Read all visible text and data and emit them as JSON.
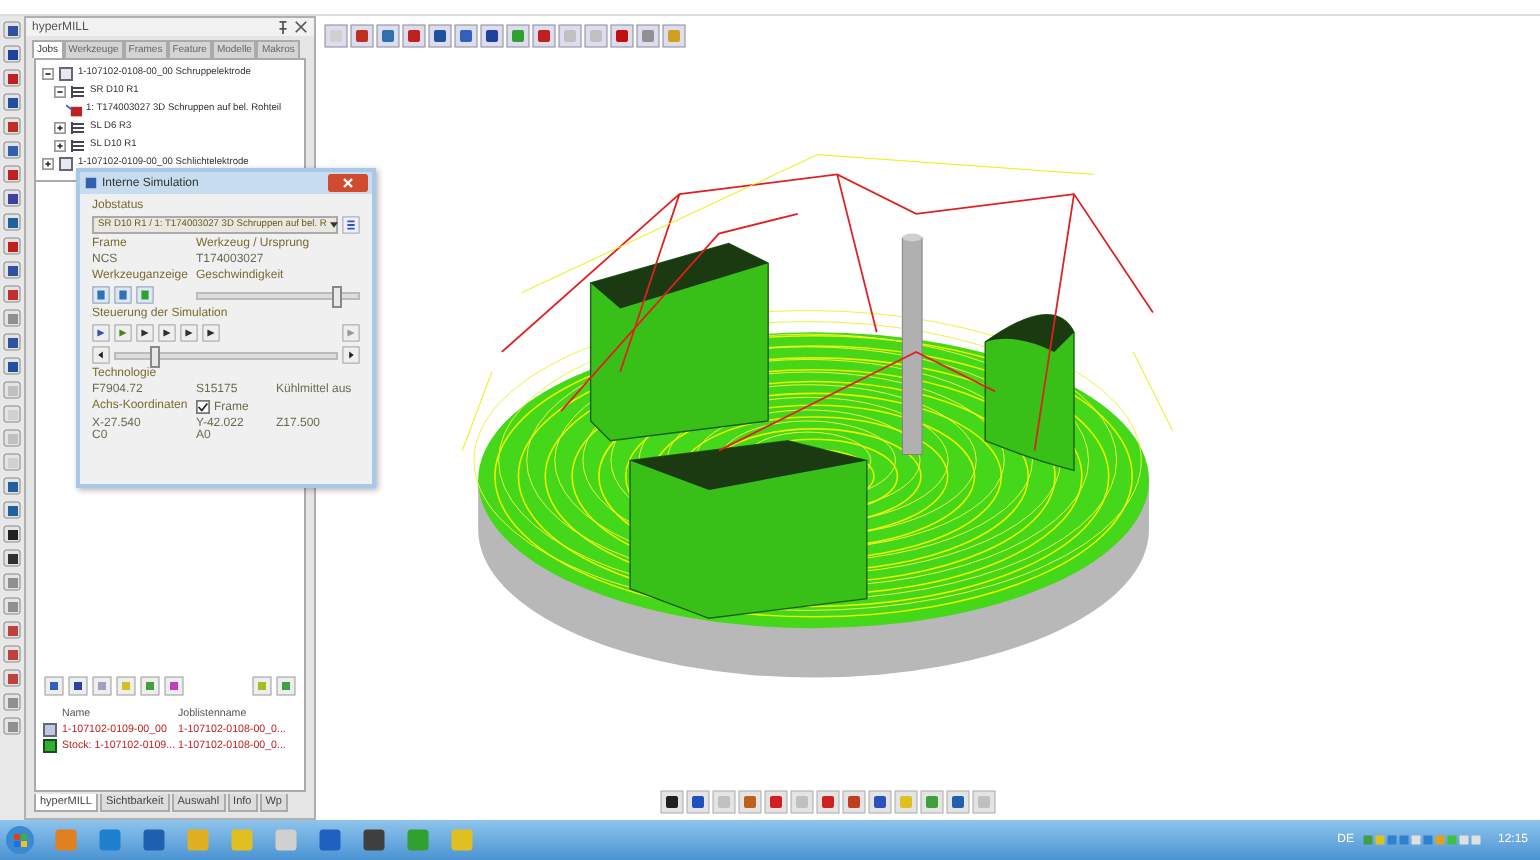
{
  "panel": {
    "title": "hyperMILL",
    "tabs": [
      {
        "label": "Jobs",
        "selected": true
      },
      {
        "label": "Werkzeuge",
        "selected": false
      },
      {
        "label": "Frames",
        "selected": false
      },
      {
        "label": "Feature",
        "selected": false
      },
      {
        "label": "Modelle",
        "selected": false
      },
      {
        "label": "Makros",
        "selected": false
      }
    ],
    "tree": [
      {
        "label": "1-107102-0108-00_00  Schruppelektrode",
        "kind": "joblist",
        "expanded": true,
        "children": [
          {
            "label": "SR D10 R1",
            "kind": "compound",
            "expanded": true,
            "children": [
              {
                "label": "1: T174003027 3D Schruppen auf bel. Rohteil",
                "kind": "job"
              }
            ]
          },
          {
            "label": "SL D6 R3",
            "kind": "compound",
            "expanded": false
          },
          {
            "label": "SL D10 R1",
            "kind": "compound",
            "expanded": false
          }
        ]
      },
      {
        "label": "1-107102-0109-00_00  Schlichtelektrode",
        "kind": "joblist",
        "expanded": false
      }
    ],
    "list": {
      "columns": [
        "Name",
        "Joblistenname"
      ],
      "rows": [
        {
          "kind": "model",
          "cells": [
            "1-107102-0109-00_00",
            "1-107102-0108-00_0..."
          ]
        },
        {
          "kind": "stock",
          "cells": [
            "Stock: 1-107102-0109...",
            "1-107102-0108-00_0..."
          ]
        }
      ]
    },
    "bottom_tabs": [
      {
        "label": "hyperMILL",
        "selected": true
      },
      {
        "label": "Sichtbarkeit",
        "selected": false
      },
      {
        "label": "Auswahl",
        "selected": false
      },
      {
        "label": "Info",
        "selected": false
      },
      {
        "label": "Wp",
        "selected": false
      }
    ]
  },
  "dialog": {
    "title": "Interne Simulation",
    "jobstatus_label": "Jobstatus",
    "jobstatus_value": "SR D10 R1 / 1: T174003027 3D Schruppen auf bel. R",
    "frame_label": "Frame",
    "frame_value": "NCS",
    "tool_label": "Werkzeug / Ursprung",
    "tool_value": "T174003027",
    "display_label": "Werkzeuganzeige",
    "speed": {
      "label": "Geschwindigkeit",
      "level": 0.85
    },
    "control_label": "Steuerung der Simulation",
    "timeline": {
      "level": 0.18
    },
    "technology_label": "Technologie",
    "technology": [
      "F7904.72",
      "S15175",
      "Kühlmittel aus"
    ],
    "axes_label": "Achs-Koordinaten",
    "frame_check": {
      "label": "Frame",
      "checked": true
    },
    "coords": [
      "X-27.540",
      "Y-42.022",
      "Z17.500",
      "C0",
      "A0"
    ]
  },
  "taskbar": {
    "language": "DE",
    "clock": "12:15"
  }
}
